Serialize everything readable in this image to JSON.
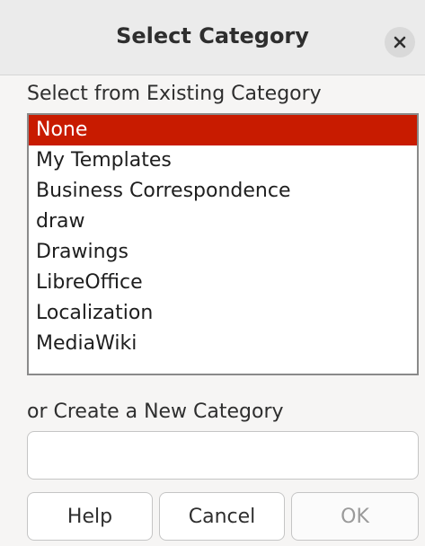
{
  "dialog": {
    "title": "Select Category",
    "close_icon": "close-icon"
  },
  "existing": {
    "label": "Select from Existing Category",
    "items": [
      "None",
      "My Templates",
      "Business Correspondence",
      "draw",
      "Drawings",
      "LibreOffice",
      "Localization",
      "MediaWiki"
    ],
    "selected_index": 0,
    "selection_color": "#c81b00"
  },
  "new_category": {
    "label": "or Create a New Category",
    "value": ""
  },
  "buttons": {
    "help": "Help",
    "cancel": "Cancel",
    "ok": "OK",
    "ok_enabled": false
  }
}
